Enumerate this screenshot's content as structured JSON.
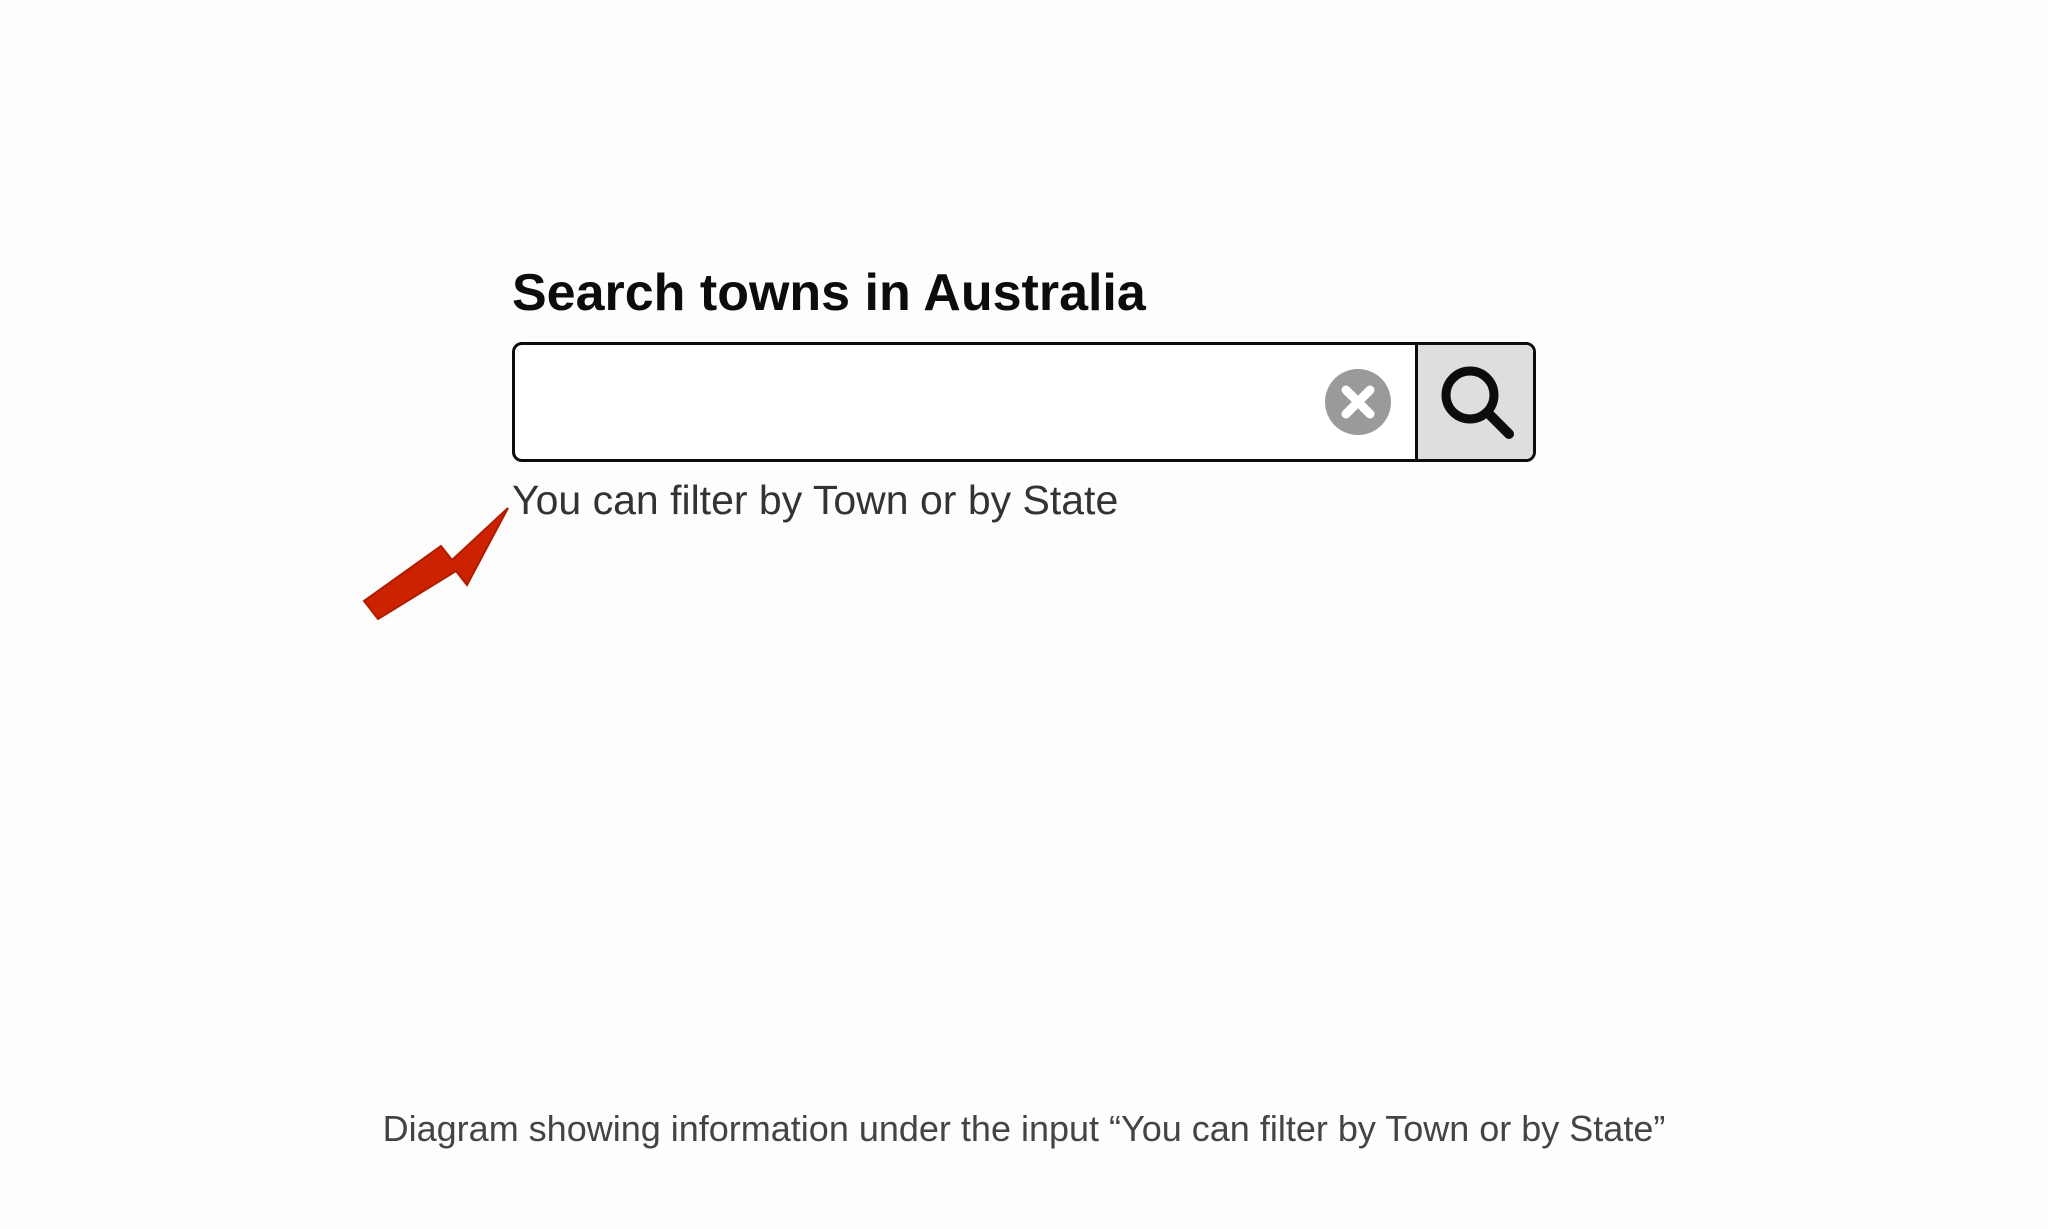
{
  "search": {
    "title": "Search towns in Australia",
    "input_value": "",
    "placeholder": "",
    "hint": "You can filter by Town or by State",
    "clear_icon": "clear-x-icon",
    "search_icon": "magnifier-icon"
  },
  "annotation": {
    "arrow_icon": "arrow-icon",
    "arrow_color": "#cc2200"
  },
  "caption": "Diagram showing information under the input “You can filter by Town or by State”",
  "colors": {
    "text": "#0b0c0c",
    "hint": "#333333",
    "clear_icon": "#9a9a9a",
    "search_button_bg": "#dedede"
  }
}
